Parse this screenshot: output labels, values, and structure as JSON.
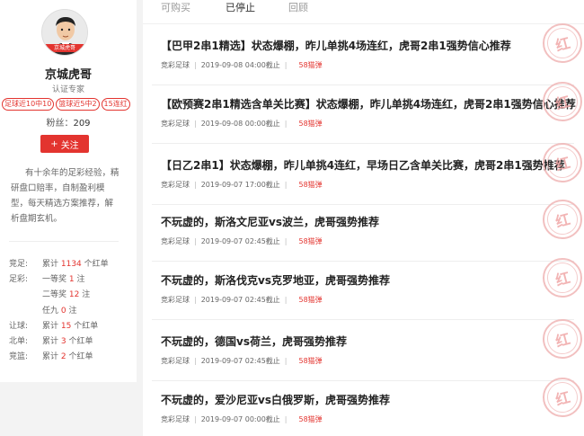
{
  "profile": {
    "avatar_tag": "京城虎哥",
    "name": "京城虎哥",
    "title": "认证专家",
    "badges": [
      "足球近10中10",
      "篮球近5中2",
      "15连红"
    ],
    "fans_label": "粉丝：",
    "fans_count": "209",
    "follow_label": "关注",
    "bio": "有十余年的足彩经验，精研盘口赔率，自制盈利模型，每天精选方案推荐，解析盘期玄机。",
    "stats": [
      {
        "label": "竞足:",
        "pre": "累计 ",
        "num": "1134",
        "post": " 个红单"
      },
      {
        "label": "足彩:",
        "pre": "一等奖 ",
        "num": "1",
        "post": " 注"
      },
      {
        "label": "",
        "pre": "二等奖 ",
        "num": "12",
        "post": " 注"
      },
      {
        "label": "",
        "pre": "任九 ",
        "num": "0",
        "post": " 注"
      },
      {
        "label": "让球:",
        "pre": "累计 ",
        "num": "15",
        "post": " 个红单"
      },
      {
        "label": "北单:",
        "pre": "累计 ",
        "num": "3",
        "post": " 个红单"
      },
      {
        "label": "竞篮:",
        "pre": "累计 ",
        "num": "2",
        "post": " 个红单"
      }
    ]
  },
  "tabs": [
    "可购买",
    "已停止",
    "回顾"
  ],
  "active_tab": "已停止",
  "items": [
    {
      "title": "【巴甲2串1精选】状态爆棚，昨儿单挑4场连红，虎哥2串1强势信心推荐",
      "category": "竞彩足球",
      "time": "2019-09-08 04:00截止",
      "price": "58猫弹",
      "stamp": "红"
    },
    {
      "title": "【欧预赛2串1精选含单关比赛】状态爆棚，昨儿单挑4场连红，虎哥2串1强势信心推荐",
      "category": "竞彩足球",
      "time": "2019-09-08 00:00截止",
      "price": "58猫弹",
      "stamp": "红"
    },
    {
      "title": "【日乙2串1】状态爆棚，昨儿单挑4连红，早场日乙含单关比赛，虎哥2串1强势推荐",
      "category": "竞彩足球",
      "time": "2019-09-07 17:00截止",
      "price": "58猫弹",
      "stamp": "红"
    },
    {
      "title": "不玩虚的，斯洛文尼亚vs波兰，虎哥强势推荐",
      "category": "竞彩足球",
      "time": "2019-09-07 02:45截止",
      "price": "58猫弹",
      "stamp": "红"
    },
    {
      "title": "不玩虚的，斯洛伐克vs克罗地亚，虎哥强势推荐",
      "category": "竞彩足球",
      "time": "2019-09-07 02:45截止",
      "price": "58猫弹",
      "stamp": "红"
    },
    {
      "title": "不玩虚的，德国vs荷兰，虎哥强势推荐",
      "category": "竞彩足球",
      "time": "2019-09-07 02:45截止",
      "price": "58猫弹",
      "stamp": "红"
    },
    {
      "title": "不玩虚的，爱沙尼亚vs白俄罗斯，虎哥强势推荐",
      "category": "竞彩足球",
      "time": "2019-09-07 00:00截止",
      "price": "58猫弹",
      "stamp": "红"
    }
  ],
  "colors": {
    "accent": "#e3342f",
    "stamp": "#f0b6b6"
  }
}
